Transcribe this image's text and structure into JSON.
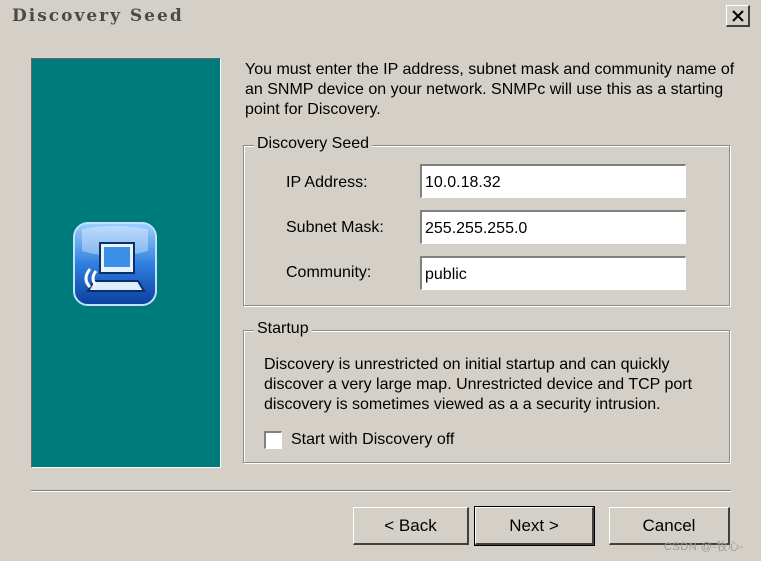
{
  "window": {
    "title": "Discovery Seed"
  },
  "intro_text": "You must enter the IP address, subnet mask and community name of an SNMP device on your network. SNMPc will use this as a starting point for Discovery.",
  "discovery_seed": {
    "legend": "Discovery Seed",
    "ip_label": "IP Address:",
    "ip_value": "10.0.18.32",
    "subnet_label": "Subnet Mask:",
    "subnet_value": "255.255.255.0",
    "community_label": "Community:",
    "community_value": "public"
  },
  "startup": {
    "legend": "Startup",
    "description": "Discovery is unrestricted on initial startup and can quickly discover a very large map.  Unrestricted device and TCP port discovery is sometimes viewed as a a security intrusion.",
    "checkbox_label": "Start with Discovery off",
    "checkbox_checked": false
  },
  "buttons": {
    "back": "< Back",
    "next": "Next >",
    "cancel": "Cancel"
  },
  "watermark": "CSDN @-牧心-",
  "icons": {
    "close": "close-icon",
    "app": "snmpc-computer-icon"
  },
  "colors": {
    "side_panel": "#007b7b",
    "dialog": "#d4d0c8"
  }
}
